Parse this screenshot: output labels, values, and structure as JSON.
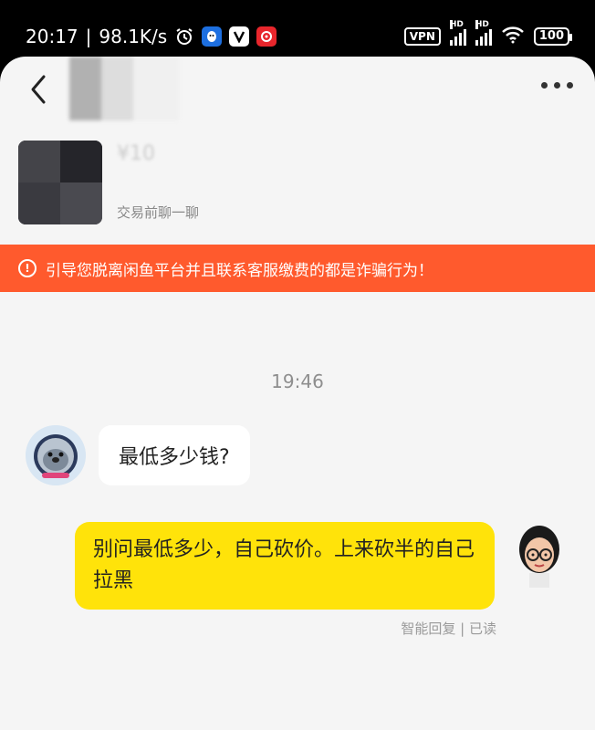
{
  "status_bar": {
    "time": "20:17",
    "separator": "|",
    "speed": "98.1K/s",
    "vpn": "VPN",
    "hd1": "HD",
    "hd2": "HD",
    "battery": "100",
    "app_icons": [
      "alarm-icon",
      "qq-icon",
      "vivo-v-icon",
      "netease-music-icon"
    ]
  },
  "header": {
    "back_icon": "chevron-left-icon",
    "more_icon": "more-dots-icon"
  },
  "product": {
    "price_blurred": "¥10",
    "subtitle": "交易前聊一聊"
  },
  "warning": {
    "text": "引导您脱离闲鱼平台并且联系客服缴费的都是诈骗行为！",
    "icon": "alert-circle-icon"
  },
  "chat": {
    "timestamp": "19:46",
    "messages": [
      {
        "side": "left",
        "text": "最低多少钱?"
      },
      {
        "side": "right",
        "text": "别问最低多少，自己砍价。上来砍半的自己拉黑"
      }
    ],
    "read_status": "智能回复 | 已读"
  },
  "colors": {
    "warning_bg": "#ff5a2d",
    "bubble_right": "#ffe30a",
    "app_bg": "#f5f5f5"
  }
}
